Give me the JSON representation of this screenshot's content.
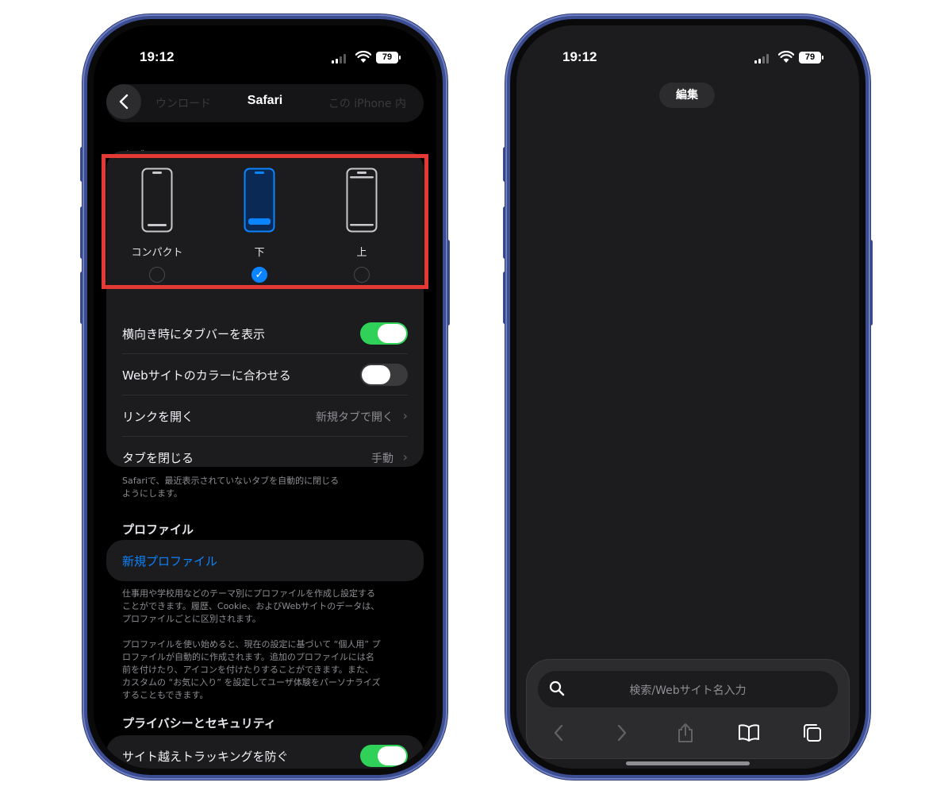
{
  "status": {
    "time": "19:12",
    "battery": "79"
  },
  "settings": {
    "nav_title": "Safari",
    "ghost_left": "ウンロード",
    "ghost_right": "この iPhone 内",
    "tabs_section": "タブ",
    "tab_layout": {
      "options": [
        {
          "label": "コンパクト",
          "selected": false
        },
        {
          "label": "下",
          "selected": true
        },
        {
          "label": "上",
          "selected": false
        }
      ]
    },
    "rows": {
      "landscape_tabbar": {
        "label": "横向き時にタブバーを表示",
        "on": true
      },
      "website_color": {
        "label": "Webサイトのカラーに合わせる",
        "on": false
      },
      "open_links": {
        "label": "リンクを開く",
        "value": "新規タブで開く"
      },
      "close_tabs": {
        "label": "タブを閉じる",
        "value": "手動"
      }
    },
    "close_tabs_note_1": "Safariで、最近表示されていないタブを自動的に閉じる",
    "close_tabs_note_2": "ようにします。",
    "profile_section": "プロファイル",
    "new_profile": "新規プロファイル",
    "profile_note_1": "仕事用や学校用などのテーマ別にプロファイルを作成し設定する",
    "profile_note_2": "ことができます。履歴、Cookie、およびWebサイトのデータは、",
    "profile_note_3": "プロファイルごとに区別されます。",
    "profile_note_4": "プロファイルを使い始めると、現在の設定に基づいて “個人用” プ",
    "profile_note_5": "ロファイルが自動的に作成されます。追加のプロファイルには名",
    "profile_note_6": "前を付けたり、アイコンを付けたりすることができます。また、",
    "profile_note_7": "カスタムの “お気に入り” を設定してユーザ体験をパーソナライズ",
    "profile_note_8": "することもできます。",
    "privacy_section": "プライバシーとセキュリティ",
    "cross_site": {
      "label": "サイト越えトラッキングを防ぐ",
      "on": true
    }
  },
  "browser": {
    "edit_label": "編集",
    "search_placeholder": "検索/Webサイト名入力"
  },
  "colors": {
    "accent_blue": "#0a84ff",
    "toggle_green": "#30d158",
    "highlight_red": "#e53935",
    "frame_blue": "#3d4d92"
  }
}
